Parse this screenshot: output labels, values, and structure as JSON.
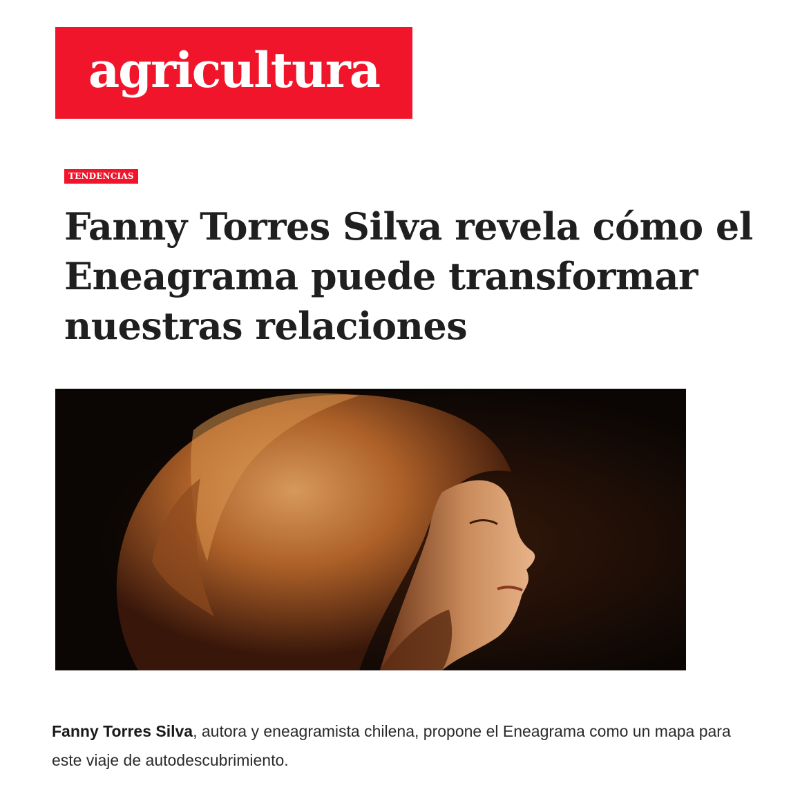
{
  "brand": {
    "logo_text": "agricultura",
    "accent_color": "#f0152a"
  },
  "article": {
    "category": "TENDENCIAS",
    "title": "Fanny Torres Silva revela cómo el Eneagrama puede transformar nuestras relaciones",
    "hero_image_alt": "Fanny Torres Silva",
    "lead_name": "Fanny Torres Silva",
    "lead_rest": ", autora y eneagramista chilena, propone el Eneagrama como un mapa para este viaje de autodescubrimiento."
  }
}
